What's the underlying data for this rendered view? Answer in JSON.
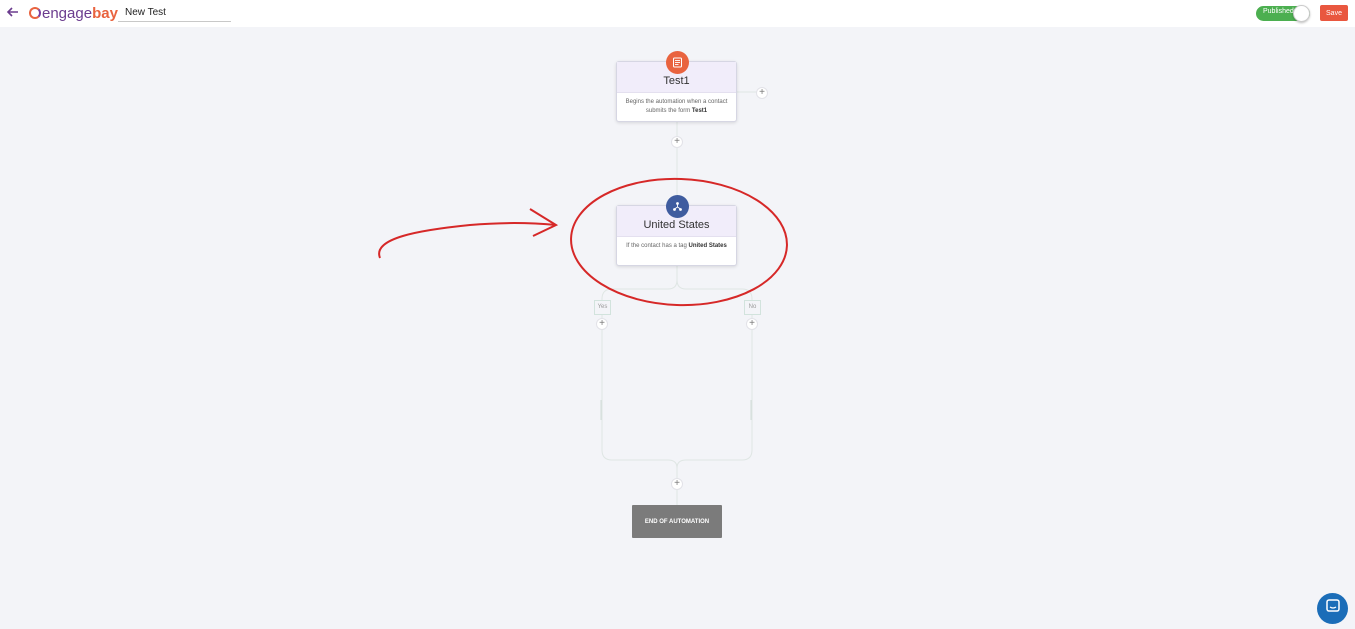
{
  "header": {
    "back_icon": "arrow-left-icon",
    "logo_engage": "engage",
    "logo_bay": "bay",
    "workflow_name": "New Test",
    "status_label": "Published",
    "save_label": "Save"
  },
  "workflow": {
    "trigger": {
      "icon": "form-icon",
      "title": "Test1",
      "desc_prefix": "Begins the automation when a contact submits the form",
      "desc_bold": "Test1"
    },
    "condition": {
      "icon": "branch-icon",
      "title": "United States",
      "desc_prefix": "If the contact has a tag",
      "desc_bold": "United States"
    },
    "branches": {
      "yes": "Yes",
      "no": "No"
    },
    "add_symbol": "+",
    "end_label": "END OF AUTOMATION"
  },
  "colors": {
    "accent": "#e9573f",
    "published": "#4caf50",
    "trigger_icon_bg": "#e9633f",
    "condition_icon_bg": "#3f5c9f",
    "annotation": "#d62828",
    "chat": "#1b6db8"
  }
}
